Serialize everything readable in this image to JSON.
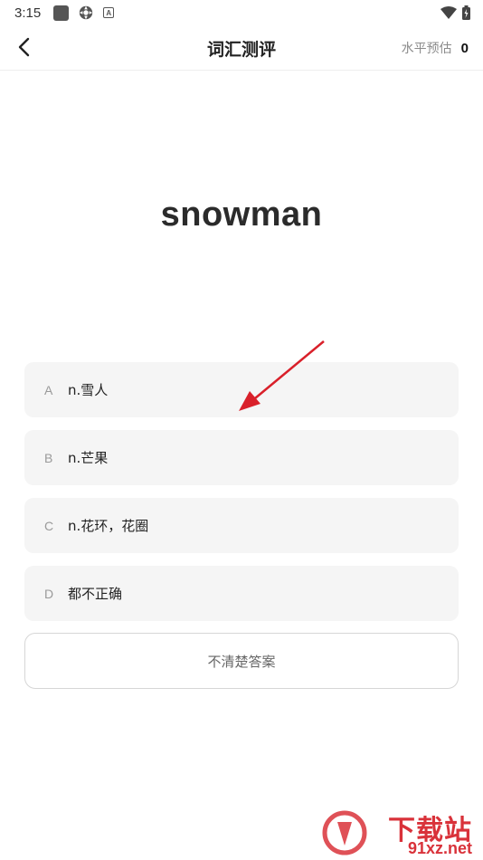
{
  "status": {
    "time": "3:15"
  },
  "header": {
    "title": "词汇测评",
    "level_label": "水平预估",
    "level_value": "0"
  },
  "question": {
    "word": "snowman"
  },
  "options": [
    {
      "letter": "A",
      "text": "n.雪人"
    },
    {
      "letter": "B",
      "text": "n.芒果"
    },
    {
      "letter": "C",
      "text": "n.花环，花圈"
    },
    {
      "letter": "D",
      "text": "都不正确"
    }
  ],
  "unsure_button": "不清楚答案",
  "watermark": {
    "brand": "下载站",
    "domain": "91xz.net"
  },
  "colors": {
    "arrow": "#d9202a",
    "option_bg": "#f5f5f5",
    "watermark": "#d9323a"
  }
}
